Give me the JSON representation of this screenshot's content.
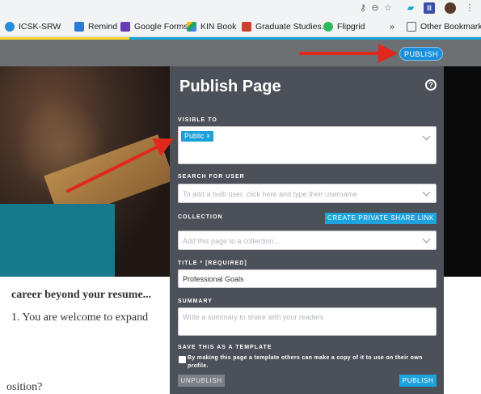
{
  "bookmarks": [
    {
      "label": "ICSK-SRW",
      "icon": "icsk-icon",
      "color": "#2a8bd8"
    },
    {
      "label": "Remind",
      "icon": "remind-icon",
      "color": "#2a7ad8"
    },
    {
      "label": "Google Forms",
      "icon": "google-forms-icon",
      "color": "#673ab7"
    },
    {
      "label": "KIN Book",
      "icon": "drive-icon",
      "color": "#1fa463"
    },
    {
      "label": "Graduate Studies...",
      "icon": "grad-studies-icon",
      "color": "#d23f31"
    },
    {
      "label": "Flipgrid",
      "icon": "flipgrid-icon",
      "color": "#30b85a"
    },
    {
      "label": "»",
      "icon": "",
      "color": ""
    },
    {
      "label": "Other Bookmarks",
      "icon": "folder-icon",
      "color": "#5f6368"
    }
  ],
  "header": {
    "publish_label": "PUBLISH"
  },
  "background_page": {
    "line1": "career beyond your resume...",
    "line2": "1. You are welcome to expand",
    "line3": "osition?"
  },
  "modal": {
    "title": "Publish Page",
    "visible_to": {
      "label": "VISIBLE TO",
      "tag": "Public ×"
    },
    "search_user": {
      "label": "SEARCH FOR USER",
      "placeholder": "To add a bulb user, click here and type their username"
    },
    "collection": {
      "label": "COLLECTION",
      "button": "CREATE PRIVATE SHARE LINK",
      "placeholder": "Add this page to a collection..."
    },
    "title_field": {
      "label": "TITLE",
      "required": "* [REQUIRED]",
      "value": "Professional Goals"
    },
    "summary": {
      "label": "SUMMARY",
      "placeholder": "Write a summary to share with your readers"
    },
    "template": {
      "label": "SAVE THIS AS A TEMPLATE",
      "description": "By making this page a template others can make a copy of it to use on their own profile."
    },
    "unpublish_label": "UNPUBLISH",
    "publish_label": "PUBLISH"
  },
  "colors": {
    "accent": "#1ea3dc",
    "modal_bg": "#4c5058",
    "header_bg": "#6d7072",
    "arrow": "#e0281c"
  }
}
